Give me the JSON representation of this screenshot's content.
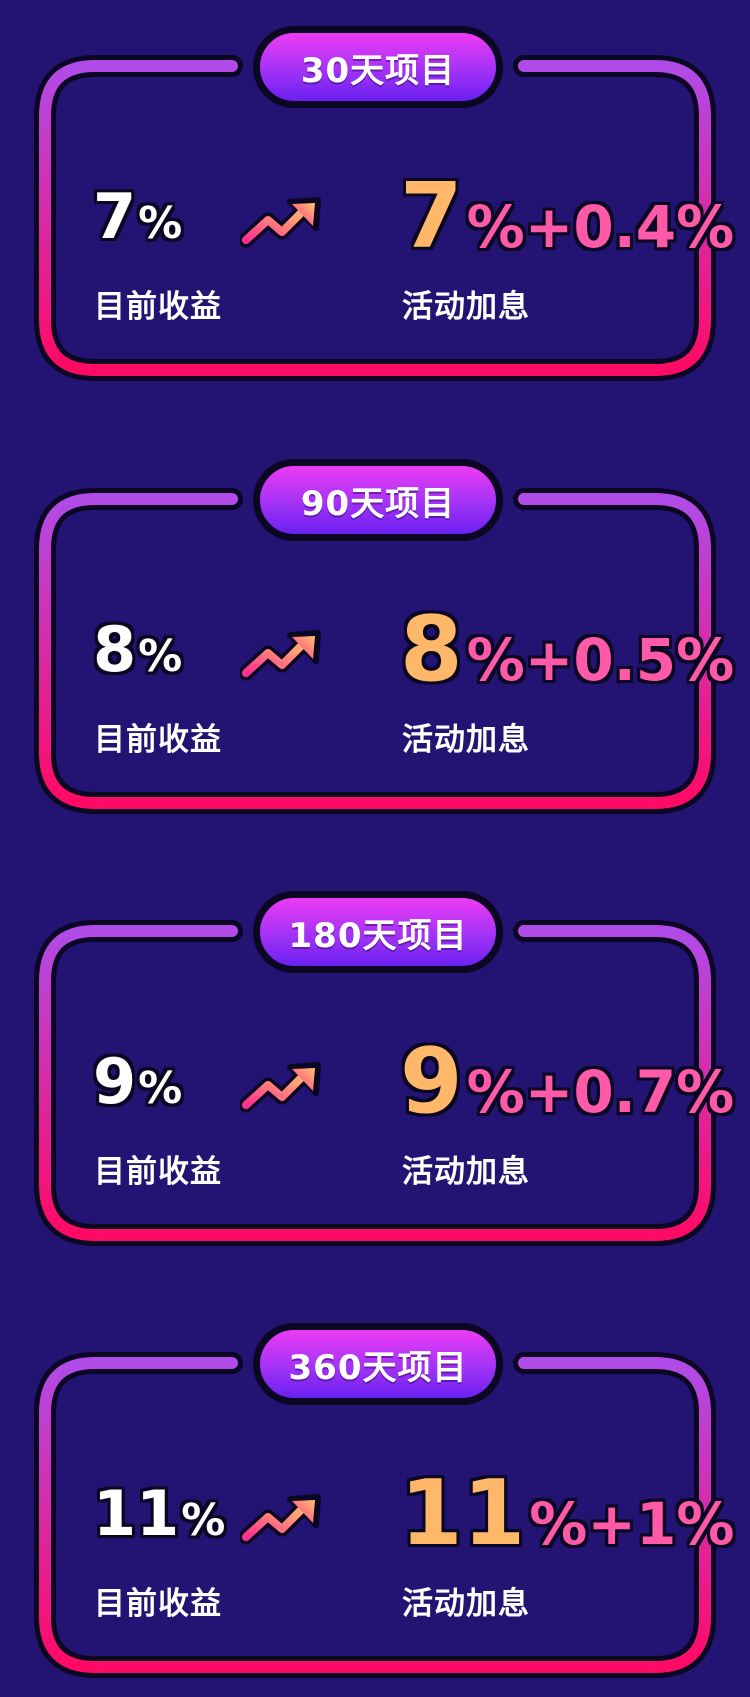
{
  "labels": {
    "current": "目前收益",
    "bonus": "活动加息"
  },
  "projects": [
    {
      "title": "30天项目",
      "current_rate": "7",
      "current_unit": "%",
      "bonus_base": "7",
      "bonus_extra": "%+0.4%"
    },
    {
      "title": "90天项目",
      "current_rate": "8",
      "current_unit": "%",
      "bonus_base": "8",
      "bonus_extra": "%+0.5%"
    },
    {
      "title": "180天项目",
      "current_rate": "9",
      "current_unit": "%",
      "bonus_base": "9",
      "bonus_extra": "%+0.7%"
    },
    {
      "title": "360天项目",
      "current_rate": "11",
      "current_unit": "%",
      "bonus_base": "11",
      "bonus_extra": "%+1%"
    }
  ],
  "icons": {
    "trend": "trend-up-arrow-icon"
  },
  "colors": {
    "background": "#231372",
    "frame_top": "#b04be8",
    "frame_bottom": "#ff0a64",
    "badge_top": "#ee3bf5",
    "badge_bottom": "#6a20f0",
    "bonus_number": "#ffb86a",
    "bonus_extra": "#ff5aa8"
  }
}
